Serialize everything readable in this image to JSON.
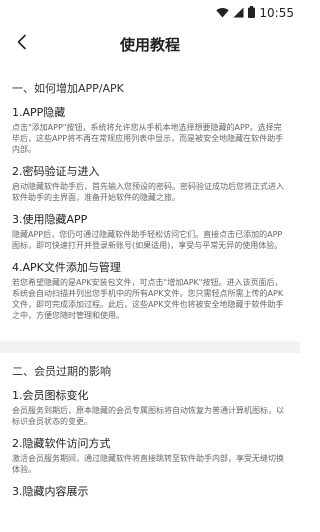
{
  "status_bar": {
    "time": "10:55"
  },
  "app_bar": {
    "title": "使用教程"
  },
  "section1": {
    "title": "一、如何增加APP/APK",
    "items": [
      {
        "title": "1.APP隐藏",
        "body": "点击\"添加APP\"按钮，系统将允许您从手机本地选择想要隐藏的APP。选择完毕后，这些APP将不再在常规应用列表中显示，而是被安全地隐藏在软件助手内部。"
      },
      {
        "title": "2.密码验证与进入",
        "body": "启动隐藏软件助手后，首先输入您预设的密码。密码验证成功后您将正式进入软件助手的主界面，准备开始软件的隐藏之旅。"
      },
      {
        "title": "3.使用隐藏APP",
        "body": "隐藏APP后，您仍可通过隐藏软件助手轻松访问它们。直接点击已添加的APP图标，即可快速打开并登录新账号(如果适用)，享受与平常无异的使用体验。"
      },
      {
        "title": "4.APK文件添加与管理",
        "body": "若您希望隐藏的是APK安装包文件，可点击\"增加APK\"按钮。进入该页面后，系统会自动扫描并列出您手机中的所有APK文件。您只需轻点所需上传的APK文件，即可完成添加过程。此后，这些APK文件也将被安全地隐藏于软件助手之中，方便您随时管理和使用。"
      }
    ]
  },
  "section2": {
    "title": "二、会员过期的影响",
    "items": [
      {
        "title": "1.会员图标变化",
        "body": "会员服务到期后，原本隐藏的会员专属图标将自动恢复为普通计算机图标，以标识会员状态的变更。"
      },
      {
        "title": "2.隐藏软件访问方式",
        "body": "激活会员服务期间，通过隐藏软件将直接跳转至软件助手内部，享受无缝切换体验。"
      },
      {
        "title": "3.隐藏内容展示",
        "body": ""
      }
    ]
  },
  "icons": {
    "back": "chevron-left-icon",
    "wifi": "wifi-icon",
    "signal": "cellular-signal-icon",
    "battery": "battery-icon"
  }
}
